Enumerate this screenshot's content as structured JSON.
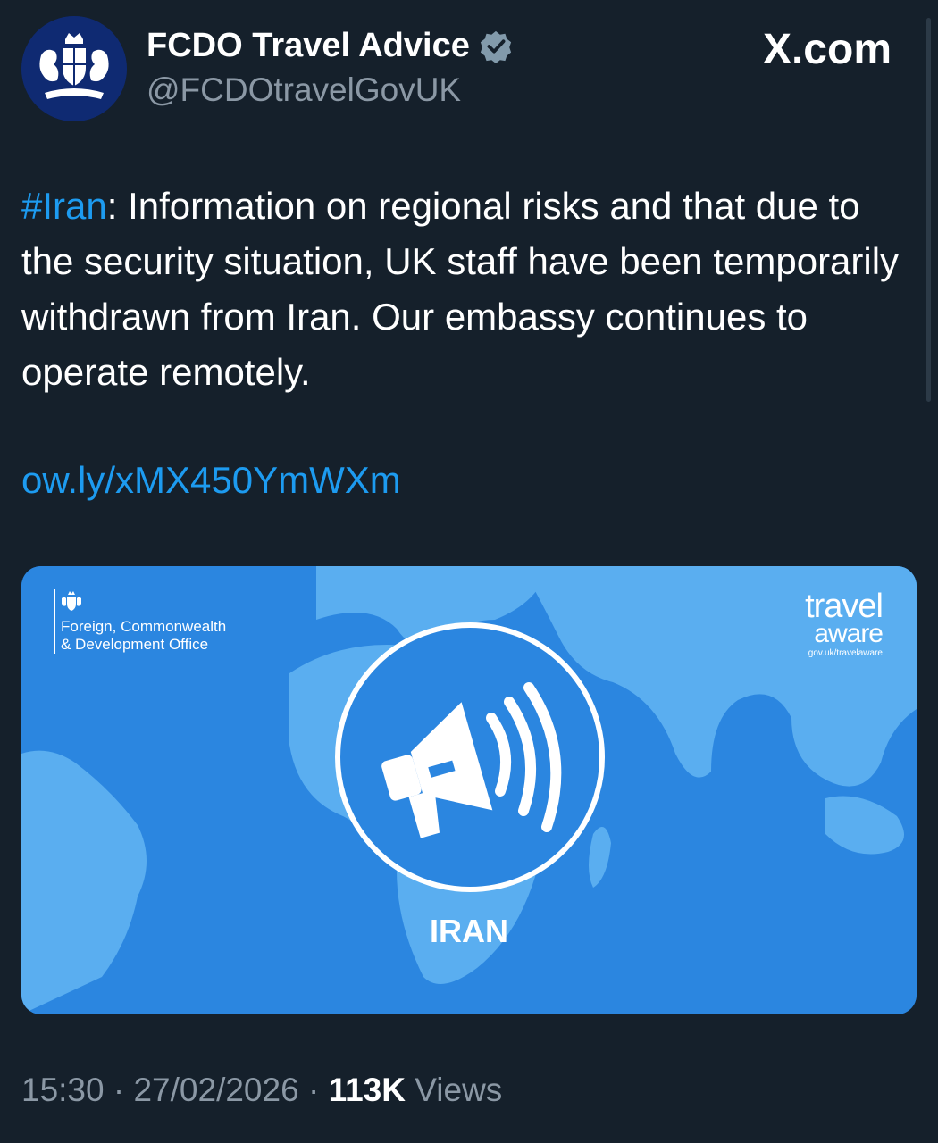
{
  "author": {
    "display_name": "FCDO Travel Advice",
    "handle": "@FCDOtravelGovUK",
    "verified": true,
    "avatar_icon": "royal-coat-of-arms-icon"
  },
  "watermark": "X.com",
  "tweet": {
    "hashtag": "#Iran",
    "text_rest": ": Information on regional risks and that due to the security situation, UK staff have been temporarily withdrawn from Iran. Our embassy continues to operate remotely.",
    "link": "ow.ly/xMX450YmWXm"
  },
  "media": {
    "org_line1": "Foreign, Commonwealth",
    "org_line2": "& Development Office",
    "brand_line1": "travel",
    "brand_line2": "aware",
    "brand_url": "gov.uk/travelaware",
    "country": "IRAN",
    "icon": "megaphone-icon",
    "colors": {
      "ocean": "#2b86e0",
      "land": "#5aaef0"
    }
  },
  "meta": {
    "time": "15:30",
    "date": "27/02/2026",
    "views_count": "113K",
    "views_label": "Views"
  },
  "colors": {
    "background": "#15202b",
    "link": "#1d9bf0",
    "secondary_text": "#8b98a5"
  }
}
